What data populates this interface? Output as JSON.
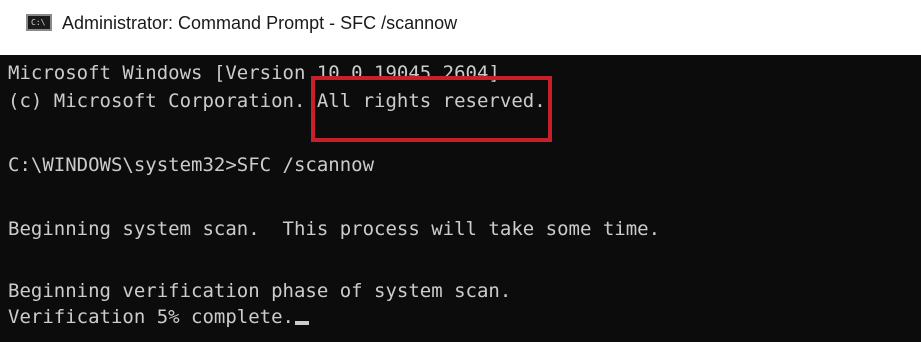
{
  "window": {
    "title": "Administrator: Command Prompt - SFC /scannow",
    "icon": "cmd-icon"
  },
  "console": {
    "version_line": "Microsoft Windows [Version 10.0.19045.2604]",
    "copyright_line": "(c) Microsoft Corporation. All rights reserved.",
    "prompt": "C:\\WINDOWS\\system32>",
    "command": "SFC /scannow",
    "scan_line": "Beginning system scan.  This process will take some time.",
    "verification_line": "Beginning verification phase of system scan.",
    "progress_line": "Verification 5% complete."
  },
  "colors": {
    "console_bg": "#0c0c0c",
    "console_text": "#cccccc",
    "highlight_border": "#c8202a"
  }
}
